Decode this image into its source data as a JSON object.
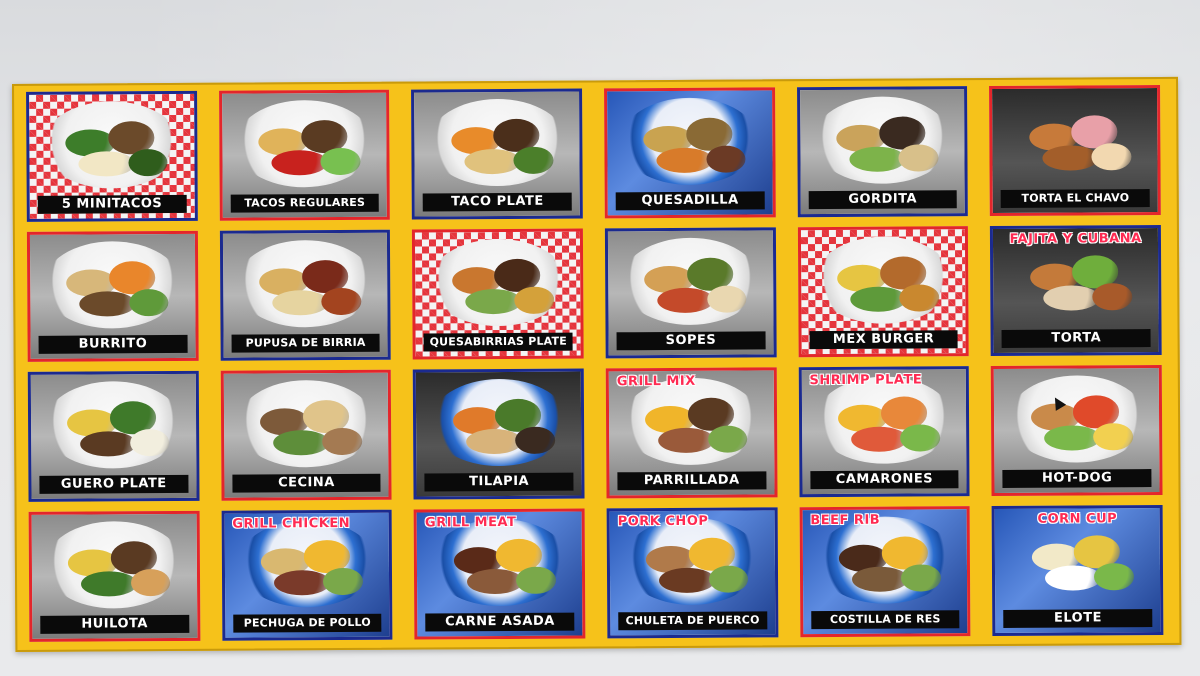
{
  "menu": {
    "rows": [
      [
        {
          "label": "5 MINITACOS",
          "banner": "",
          "border": "blue",
          "bg": "check",
          "plate": "white",
          "colors": [
            "#3d7d2a",
            "#6b4a2a",
            "#f2e7c5",
            "#2f5d1c"
          ]
        },
        {
          "label": "TACOS REGULARES",
          "banner": "",
          "border": "red",
          "bg": "wood",
          "plate": "white",
          "colors": [
            "#e0b35a",
            "#5a3b22",
            "#c8221e",
            "#78c050"
          ]
        },
        {
          "label": "TACO PLATE",
          "banner": "",
          "border": "blue",
          "bg": "wood",
          "plate": "white",
          "colors": [
            "#e88b2a",
            "#4b2f1b",
            "#e0c27d",
            "#4b7f2a"
          ]
        },
        {
          "label": "QUESADILLA",
          "banner": "",
          "border": "red",
          "bg": "bluecloth",
          "plate": "blue",
          "colors": [
            "#c9a350",
            "#8a6a35",
            "#d87b2a",
            "#6b3a25"
          ]
        },
        {
          "label": "GORDITA",
          "banner": "",
          "border": "blue",
          "bg": "wood",
          "plate": "white",
          "colors": [
            "#caa35b",
            "#3a2a20",
            "#7db34a",
            "#d8c08a"
          ]
        },
        {
          "label": "TORTA EL CHAVO",
          "banner": "",
          "border": "red",
          "bg": "dark",
          "plate": "none",
          "colors": [
            "#c77a3a",
            "#e8a0a8",
            "#a35e2a",
            "#f2d8b0"
          ]
        }
      ],
      [
        {
          "label": "BURRITO",
          "banner": "",
          "border": "red",
          "bg": "wood",
          "plate": "white",
          "colors": [
            "#d7b77a",
            "#e9862b",
            "#6b4a2a",
            "#5f9a3a"
          ]
        },
        {
          "label": "PUPUSA DE BIRRIA",
          "banner": "",
          "border": "blue",
          "bg": "wood",
          "plate": "white",
          "colors": [
            "#d9b061",
            "#7a2a1a",
            "#e6d4a0",
            "#a3441f"
          ]
        },
        {
          "label": "QUESABIRRIAS PLATE",
          "banner": "",
          "border": "red",
          "bg": "check",
          "plate": "white",
          "colors": [
            "#c9772f",
            "#4a2a18",
            "#7aa84a",
            "#d4a13a"
          ]
        },
        {
          "label": "SOPES",
          "banner": "",
          "border": "blue",
          "bg": "wood",
          "plate": "white",
          "colors": [
            "#d4a055",
            "#5a7a2a",
            "#c44a2a",
            "#e9d7b0"
          ]
        },
        {
          "label": "MEX BURGER",
          "banner": "",
          "border": "red",
          "bg": "check",
          "plate": "white",
          "colors": [
            "#e6c542",
            "#b36a2c",
            "#5e9a3a",
            "#c9882f"
          ]
        },
        {
          "label": "TORTA",
          "banner": "FAJITA Y CUBANA",
          "border": "blue",
          "bg": "dark",
          "plate": "none",
          "colors": [
            "#c47a3a",
            "#6fae3c",
            "#e2cfb0",
            "#a85a2a"
          ]
        }
      ],
      [
        {
          "label": "GUERO PLATE",
          "banner": "",
          "border": "blue",
          "bg": "wood",
          "plate": "white",
          "colors": [
            "#e6c542",
            "#3f7a2a",
            "#5a3a22",
            "#f2eede"
          ]
        },
        {
          "label": "CECINA",
          "banner": "",
          "border": "red",
          "bg": "wood",
          "plate": "white",
          "colors": [
            "#7d5a3a",
            "#e0c48a",
            "#5e8e3a",
            "#a47a52"
          ]
        },
        {
          "label": "TILAPIA",
          "banner": "",
          "border": "blue",
          "bg": "dark",
          "plate": "blue",
          "colors": [
            "#e07a2a",
            "#4a7a2a",
            "#d8b37a",
            "#3a2a20"
          ]
        },
        {
          "label": "PARRILLADA",
          "banner": "GRILL MIX",
          "border": "red",
          "bg": "wood",
          "plate": "white",
          "colors": [
            "#f0b52a",
            "#5a3a22",
            "#9a5a3a",
            "#7aa84a"
          ]
        },
        {
          "label": "CAMARONES",
          "banner": "SHRIMP PLATE",
          "border": "blue",
          "bg": "wood",
          "plate": "white",
          "colors": [
            "#f0b830",
            "#e8883a",
            "#e05a3a",
            "#7ab84a"
          ]
        },
        {
          "label": "HOT-DOG",
          "banner": "",
          "border": "red",
          "bg": "wood",
          "plate": "white",
          "colors": [
            "#c98a4a",
            "#e04a2a",
            "#7ab84a",
            "#f2d050"
          ]
        }
      ],
      [
        {
          "label": "HUILOTA",
          "banner": "",
          "border": "red",
          "bg": "wood",
          "plate": "white",
          "colors": [
            "#e6c542",
            "#5a3a22",
            "#3f7a2a",
            "#d7a05a"
          ]
        },
        {
          "label": "PECHUGA DE POLLO",
          "banner": "GRILL CHICKEN",
          "border": "blue",
          "bg": "bluecloth",
          "plate": "blue",
          "colors": [
            "#d9b870",
            "#f0b830",
            "#7a3a2a",
            "#7aa84a"
          ]
        },
        {
          "label": "CARNE ASADA",
          "banner": "GRILL MEAT",
          "border": "red",
          "bg": "bluecloth",
          "plate": "blue",
          "colors": [
            "#5a2a18",
            "#f0b830",
            "#8a5a3a",
            "#7aa84a"
          ]
        },
        {
          "label": "CHULETA DE PUERCO",
          "banner": "PORK CHOP",
          "border": "blue",
          "bg": "bluecloth",
          "plate": "blue",
          "colors": [
            "#b07a4a",
            "#f0b830",
            "#6a3a22",
            "#7aa84a"
          ]
        },
        {
          "label": "COSTILLA DE RES",
          "banner": "BEEF RIB",
          "border": "red",
          "bg": "bluecloth",
          "plate": "blue",
          "colors": [
            "#4a2a1a",
            "#f0b830",
            "#7a5a3a",
            "#7aa84a"
          ]
        },
        {
          "label": "ELOTE",
          "banner": "CORN CUP",
          "border": "blue",
          "bg": "bluecloth",
          "plate": "none",
          "colors": [
            "#f2e9c8",
            "#e6c542",
            "#ffffff",
            "#7ab84a"
          ]
        }
      ]
    ]
  }
}
